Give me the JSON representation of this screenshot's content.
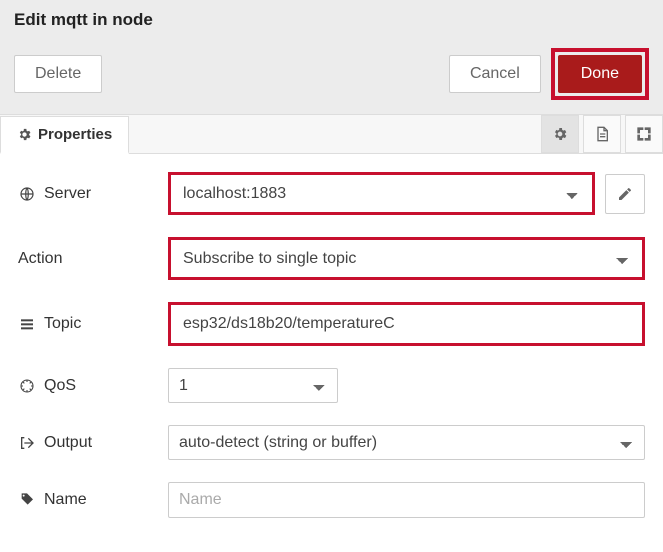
{
  "header": {
    "title": "Edit mqtt in node"
  },
  "buttons": {
    "delete": "Delete",
    "cancel": "Cancel",
    "done": "Done"
  },
  "tabs": {
    "properties": "Properties"
  },
  "labels": {
    "server": "Server",
    "action": "Action",
    "topic": "Topic",
    "qos": "QoS",
    "output": "Output",
    "name": "Name"
  },
  "fields": {
    "server": "localhost:1883",
    "action": "Subscribe to single topic",
    "topic": "esp32/ds18b20/temperatureC",
    "qos": "1",
    "output": "auto-detect (string or buffer)",
    "name_value": "",
    "name_placeholder": "Name"
  }
}
